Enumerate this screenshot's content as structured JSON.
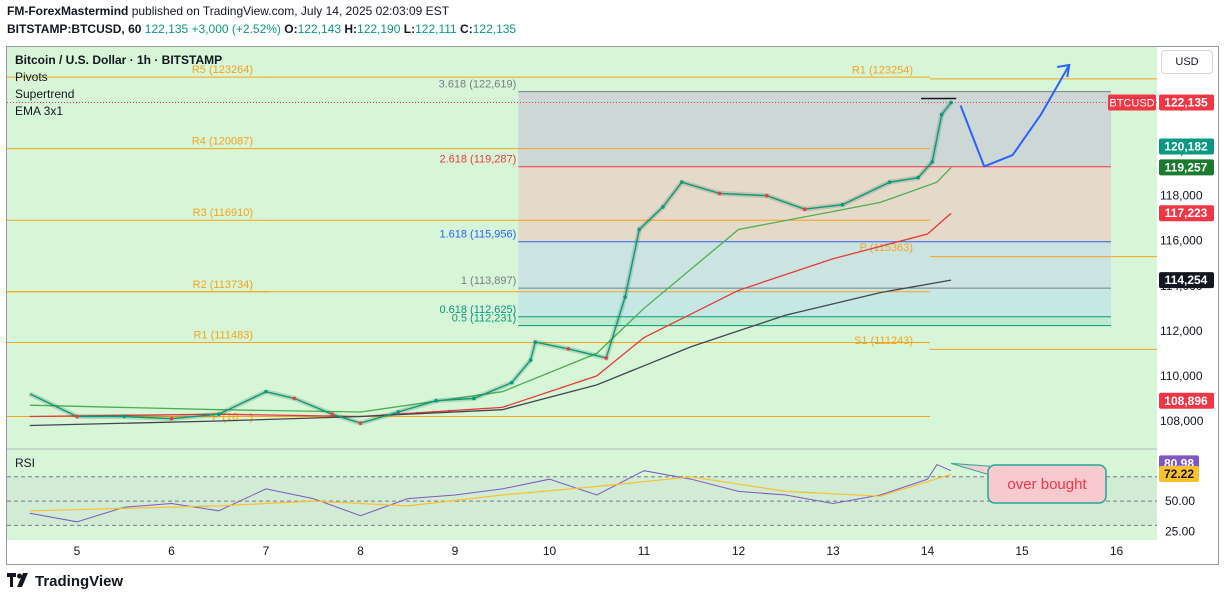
{
  "header": {
    "author": "FM-ForexMastermind",
    "published_text": "published on TradingView.com, July 14, 2025 02:03:09 EST",
    "symbol_line": "BITSTAMP:BTCUSD, 60",
    "last": "122,135",
    "change": "+3,000 (+2.52%)",
    "o_label": "O:",
    "o": "122,143",
    "h_label": "H:",
    "h": "122,190",
    "l_label": "L:",
    "l": "122,111",
    "c_label": "C:",
    "c": "122,135"
  },
  "legend": {
    "title": "Bitcoin / U.S. Dollar · 1h · BITSTAMP",
    "items": [
      "Pivots",
      "Supertrend",
      "EMA 3x1"
    ]
  },
  "currency_button": "USD",
  "footer": {
    "brand": "TradingView"
  },
  "colors": {
    "up": "#089981",
    "down": "#f23645",
    "pivot": "#f7a21b",
    "fib_red": "#f23645",
    "fib_blue": "#2962ff",
    "fib_gray": "#787b86",
    "fib_green": "#089981",
    "ema_green": "#4caf50",
    "ema_red": "#e53935",
    "ema_dark": "#434651",
    "rsi": "#7e57c2",
    "rsi_ma": "#fbc02d",
    "arrow": "#2962ff",
    "bg_green": "#d7f5d7"
  },
  "chart_data": {
    "type": "line",
    "title": "Bitcoin / U.S. Dollar · 1h · BITSTAMP",
    "x_ticks": [
      "5",
      "6",
      "7",
      "8",
      "9",
      "10",
      "11",
      "12",
      "13",
      "14",
      "15",
      "16"
    ],
    "ylim": [
      106800,
      124600
    ],
    "y_ticks": [
      "122,000",
      "120,000",
      "118,000",
      "116,000",
      "114,000",
      "112,000",
      "110,000",
      "108,000"
    ],
    "y_tick_values": [
      122000,
      120000,
      118000,
      116000,
      114000,
      112000,
      110000,
      108000
    ],
    "price_series": [
      {
        "day": 4.5,
        "close": 109200
      },
      {
        "day": 5.0,
        "close": 108200
      },
      {
        "day": 5.5,
        "close": 108200
      },
      {
        "day": 6.0,
        "close": 108100
      },
      {
        "day": 6.5,
        "close": 108300
      },
      {
        "day": 7.0,
        "close": 109300
      },
      {
        "day": 7.3,
        "close": 109000
      },
      {
        "day": 7.7,
        "close": 108300
      },
      {
        "day": 8.0,
        "close": 107900
      },
      {
        "day": 8.4,
        "close": 108400
      },
      {
        "day": 8.8,
        "close": 108900
      },
      {
        "day": 9.2,
        "close": 109000
      },
      {
        "day": 9.6,
        "close": 109700
      },
      {
        "day": 9.8,
        "close": 110700
      },
      {
        "day": 9.85,
        "close": 111500
      },
      {
        "day": 10.2,
        "close": 111200
      },
      {
        "day": 10.6,
        "close": 110800
      },
      {
        "day": 10.8,
        "close": 113500
      },
      {
        "day": 10.95,
        "close": 116500
      },
      {
        "day": 11.2,
        "close": 117500
      },
      {
        "day": 11.4,
        "close": 118600
      },
      {
        "day": 11.8,
        "close": 118100
      },
      {
        "day": 12.3,
        "close": 118000
      },
      {
        "day": 12.7,
        "close": 117400
      },
      {
        "day": 13.1,
        "close": 117600
      },
      {
        "day": 13.6,
        "close": 118600
      },
      {
        "day": 13.9,
        "close": 118800
      },
      {
        "day": 14.05,
        "close": 119500
      },
      {
        "day": 14.15,
        "close": 121600
      },
      {
        "day": 14.25,
        "close": 122135
      }
    ],
    "projection": [
      {
        "day": 14.35,
        "price": 122000
      },
      {
        "day": 14.6,
        "price": 119300
      },
      {
        "day": 14.9,
        "price": 119800
      },
      {
        "day": 15.2,
        "price": 121600
      },
      {
        "day": 15.5,
        "price": 123800
      }
    ],
    "pivots": [
      {
        "label": "R5 (123264)",
        "value": 123264
      },
      {
        "label": "R4 (120087)",
        "value": 120087
      },
      {
        "label": "R3 (116910)",
        "value": 116910
      },
      {
        "label": "R2 (113734)",
        "value": 113734
      },
      {
        "label": "R1 (111483)",
        "value": 111483
      },
      {
        "label": "P (10…)",
        "value": 108200
      },
      {
        "label": "R1 (123254)",
        "value": 123254
      },
      {
        "label": "P (115363)",
        "value": 115363
      },
      {
        "label": "S1 (111243)",
        "value": 111243
      }
    ],
    "fibonacci": [
      {
        "label": "3.618 (122,619)",
        "value": 122619,
        "color": "gray"
      },
      {
        "label": "2.618 (119,287)",
        "value": 119287,
        "color": "red"
      },
      {
        "label": "1.618 (115,956)",
        "value": 115956,
        "color": "blue"
      },
      {
        "label": "1 (113,897)",
        "value": 113897,
        "color": "gray"
      },
      {
        "label": "0.618 (112,625)",
        "value": 112625,
        "color": "green"
      },
      {
        "label": "0.5 (112,231)",
        "value": 112231,
        "color": "green"
      }
    ],
    "ema_series": [
      {
        "name": "",
        "color": "green",
        "points": [
          [
            4.5,
            108700
          ],
          [
            6.5,
            108500
          ],
          [
            8.0,
            108400
          ],
          [
            9.5,
            109300
          ],
          [
            10.5,
            111000
          ],
          [
            11.0,
            113000
          ],
          [
            12.0,
            116500
          ],
          [
            13.0,
            117300
          ],
          [
            13.5,
            117700
          ],
          [
            14.1,
            118600
          ],
          [
            14.25,
            119257
          ]
        ]
      },
      {
        "name": "",
        "color": "red",
        "points": [
          [
            4.5,
            108200
          ],
          [
            6.5,
            108300
          ],
          [
            8.0,
            108200
          ],
          [
            9.5,
            108600
          ],
          [
            10.5,
            110000
          ],
          [
            11.0,
            111700
          ],
          [
            12.0,
            113800
          ],
          [
            13.0,
            115200
          ],
          [
            14.0,
            116300
          ],
          [
            14.25,
            117223
          ]
        ]
      },
      {
        "name": "",
        "color": "dark",
        "points": [
          [
            4.5,
            107800
          ],
          [
            6.5,
            108000
          ],
          [
            8.0,
            108200
          ],
          [
            9.5,
            108500
          ],
          [
            10.5,
            109600
          ],
          [
            11.5,
            111300
          ],
          [
            12.5,
            112700
          ],
          [
            13.5,
            113700
          ],
          [
            14.25,
            114254
          ]
        ]
      }
    ],
    "price_tags": [
      {
        "text": "122,135",
        "value": 122135,
        "color": "red",
        "symbol": "BTCUSD"
      },
      {
        "text": "120,182",
        "value": 120182,
        "color": "green"
      },
      {
        "text": "119,257",
        "value": 119257,
        "color": "darkgreen"
      },
      {
        "text": "117,223",
        "value": 117223,
        "color": "red"
      },
      {
        "text": "114,254",
        "value": 114254,
        "color": "black"
      },
      {
        "text": "108,896",
        "value": 108896,
        "color": "red"
      }
    ],
    "rsi": {
      "label": "RSI",
      "ylim": [
        18,
        92
      ],
      "y_ticks": [
        "25.00",
        "50.00"
      ],
      "y_tick_values": [
        25,
        50
      ],
      "bands": [
        30,
        50,
        70
      ],
      "rsi_value": "80.98",
      "rsi_numeric": 80.98,
      "ma_value": "72.22",
      "ma_numeric": 72.22,
      "annotation": "over bought",
      "series": [
        [
          4.5,
          40
        ],
        [
          5.0,
          33
        ],
        [
          5.5,
          45
        ],
        [
          6.0,
          48
        ],
        [
          6.5,
          42
        ],
        [
          7.0,
          60
        ],
        [
          7.5,
          52
        ],
        [
          8.0,
          38
        ],
        [
          8.5,
          52
        ],
        [
          9.0,
          55
        ],
        [
          9.5,
          60
        ],
        [
          10.0,
          68
        ],
        [
          10.5,
          55
        ],
        [
          11.0,
          75
        ],
        [
          11.5,
          68
        ],
        [
          12.0,
          58
        ],
        [
          12.5,
          55
        ],
        [
          13.0,
          48
        ],
        [
          13.5,
          55
        ],
        [
          14.0,
          68
        ],
        [
          14.1,
          80
        ],
        [
          14.25,
          75
        ]
      ],
      "ma_series": [
        [
          4.5,
          42
        ],
        [
          5.5,
          44
        ],
        [
          6.5,
          46
        ],
        [
          7.5,
          50
        ],
        [
          8.5,
          46
        ],
        [
          9.5,
          55
        ],
        [
          10.5,
          62
        ],
        [
          11.5,
          70
        ],
        [
          12.5,
          58
        ],
        [
          13.5,
          54
        ],
        [
          14.25,
          72
        ]
      ]
    }
  }
}
